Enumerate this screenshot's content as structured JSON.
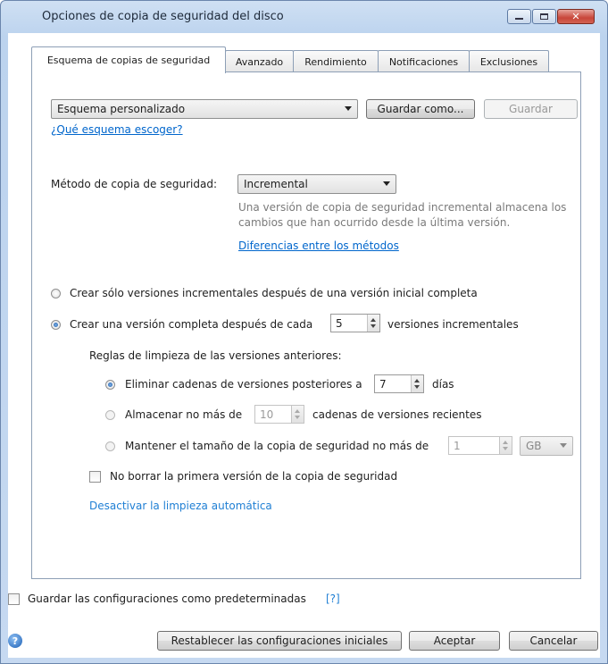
{
  "window": {
    "title": "Opciones de copia de seguridad del disco"
  },
  "tabs": [
    "Esquema de copias de seguridad",
    "Avanzado",
    "Rendimiento",
    "Notificaciones",
    "Exclusiones"
  ],
  "scheme": {
    "selected": "Esquema personalizado",
    "save_as_label": "Guardar como...",
    "save_label": "Guardar",
    "which_scheme_link": "¿Qué esquema escoger?"
  },
  "method": {
    "label": "Método de copia de seguridad:",
    "selected": "Incremental",
    "description": "Una versión de copia de seguridad incremental almacena los cambios que han ocurrido desde la última versión.",
    "diff_link": "Diferencias entre los métodos"
  },
  "options": {
    "radio_incremental_only": "Crear sólo versiones incrementales después de una versión inicial completa",
    "radio_full_after_prefix": "Crear una versión completa después de cada",
    "full_after_value": "5",
    "radio_full_after_suffix": "versiones incrementales"
  },
  "cleanup": {
    "header": "Reglas de limpieza de las versiones anteriores:",
    "delete_chains_prefix": "Eliminar cadenas de versiones posteriores a",
    "delete_chains_value": "7",
    "delete_chains_suffix": "días",
    "store_max_prefix": "Almacenar no más de",
    "store_max_value": "10",
    "store_max_suffix": "cadenas de versiones recientes",
    "keep_size_prefix": "Mantener el tamaño de la copia de seguridad no más de",
    "keep_size_value": "1",
    "keep_size_unit": "GB",
    "no_delete_first": "No borrar la primera versión de la copia de seguridad",
    "disable_link": "Desactivar la limpieza automática"
  },
  "footer": {
    "save_default": "Guardar las configuraciones como predeterminadas",
    "save_default_help": "[?]",
    "reset_label": "Restablecer las configuraciones iniciales",
    "ok_label": "Aceptar",
    "cancel_label": "Cancelar"
  }
}
